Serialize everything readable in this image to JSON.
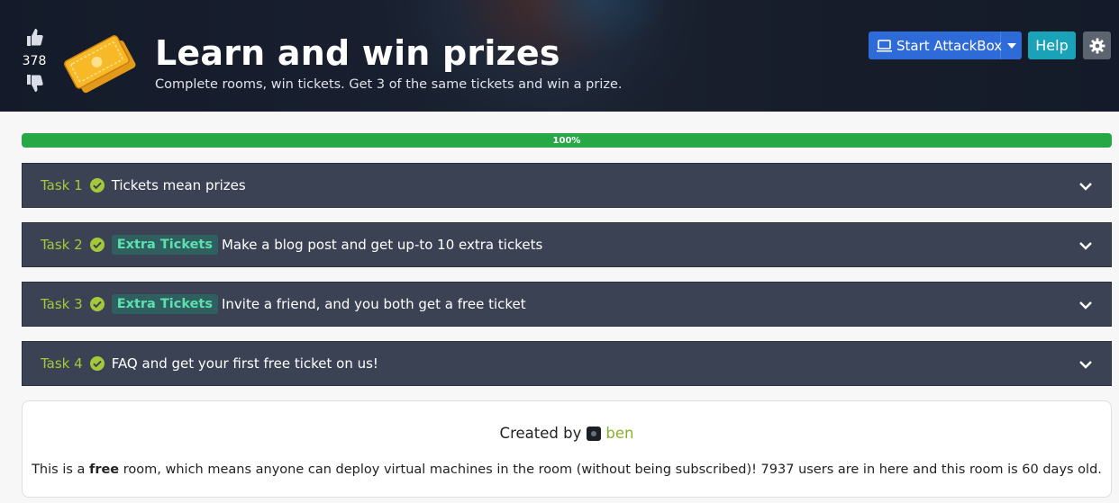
{
  "header": {
    "title": "Learn and win prizes",
    "subtitle": "Complete rooms, win tickets. Get 3 of the same tickets and win a prize.",
    "votes": "378"
  },
  "toolbar": {
    "attackbox_label": "Start AttackBox",
    "help_label": "Help"
  },
  "progress": {
    "label": "100%",
    "value": 100
  },
  "tasks": [
    {
      "number": "Task 1",
      "badge": "",
      "title": "Tickets mean prizes"
    },
    {
      "number": "Task 2",
      "badge": "Extra Tickets",
      "title": "Make a blog post and get up-to 10 extra tickets"
    },
    {
      "number": "Task 3",
      "badge": "Extra Tickets",
      "title": "Invite a friend, and you both get a free ticket"
    },
    {
      "number": "Task 4",
      "badge": "",
      "title": "FAQ and get your first free ticket on us!"
    }
  ],
  "info": {
    "created_by": "Created by",
    "author": "ben",
    "text_before": "This is a ",
    "text_bold": "free",
    "text_after": " room, which means anyone can deploy virtual machines in the room (without being subscribed)! 7937 users are in here and this room is 60 days old."
  },
  "colors": {
    "accent_green": "#28a745",
    "task_bg": "#3a4254",
    "badge_text": "#5ce0b0",
    "attackbox_blue": "#2e6bd8",
    "help_teal": "#1aa2b8"
  },
  "icons": [
    "thumbs-up-icon",
    "thumbs-down-icon",
    "ticket-icon",
    "laptop-icon",
    "caret-down-icon",
    "gear-icon",
    "check-circle-icon",
    "chevron-down-icon",
    "avatar"
  ]
}
